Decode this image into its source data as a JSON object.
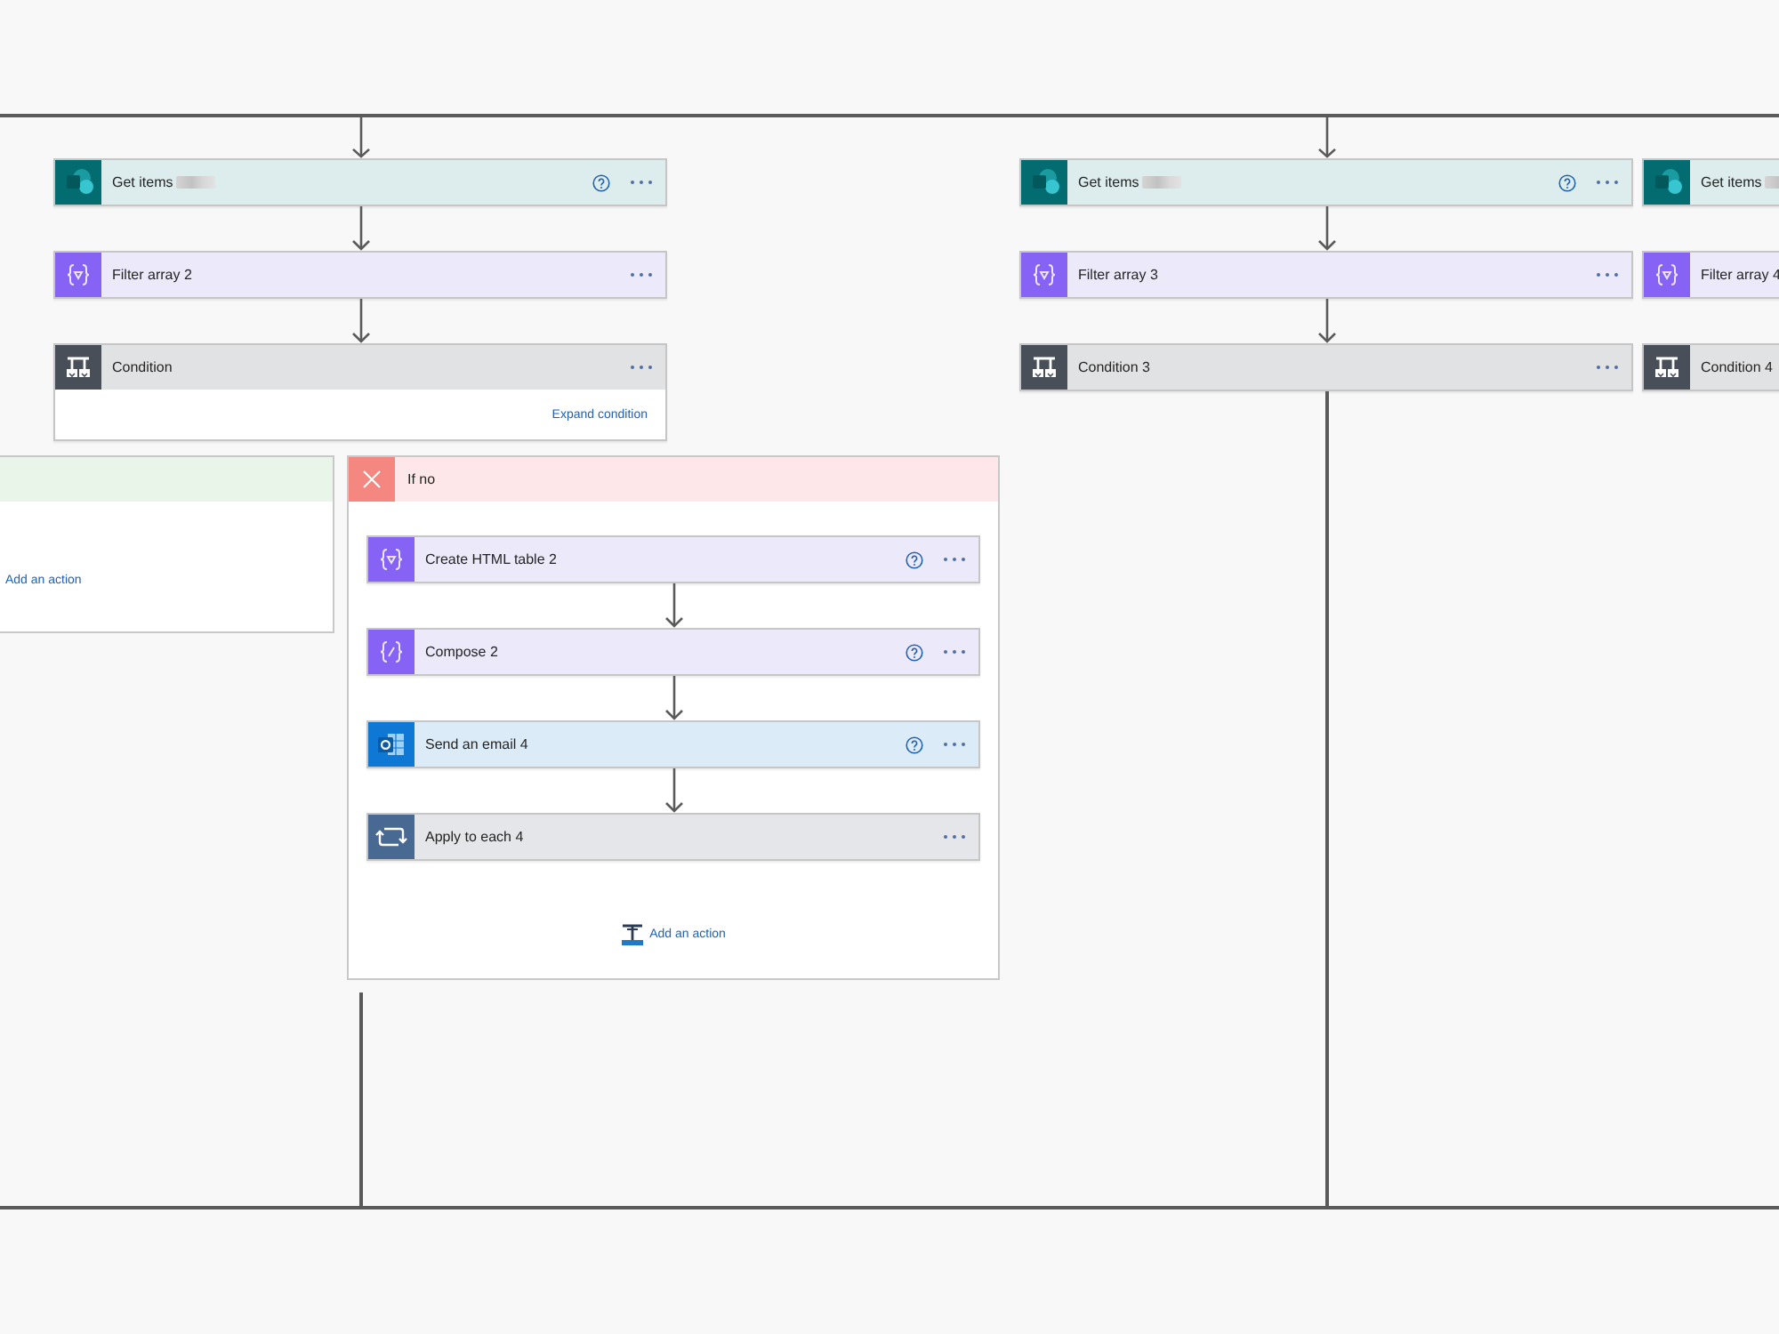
{
  "canvas": {
    "columns": [
      {
        "actions": [
          {
            "kind": "sharepoint",
            "title": "Get items",
            "redacted": true,
            "help": true
          },
          {
            "kind": "filter",
            "title": "Filter array 2",
            "redacted": false,
            "help": false
          }
        ],
        "condition": {
          "title": "Condition",
          "link": "Expand condition"
        },
        "branches": [
          {
            "kind": "yes",
            "add_action": {
              "label": "Add an action",
              "icon": false
            }
          },
          {
            "kind": "no",
            "title": "If no",
            "actions": [
              {
                "kind": "table",
                "title": "Create HTML table 2",
                "redacted": false,
                "help": true
              },
              {
                "kind": "compose",
                "title": "Compose 2",
                "redacted": false,
                "help": true
              },
              {
                "kind": "email",
                "title": "Send an email 4",
                "redacted": false,
                "help": true
              },
              {
                "kind": "loop",
                "title": "Apply to each 4",
                "redacted": false,
                "help": false
              }
            ],
            "add_action": {
              "label": "Add an action",
              "icon": true
            }
          }
        ]
      },
      {
        "actions": [
          {
            "kind": "sharepoint",
            "title": "Get items",
            "redacted": true,
            "help": true
          },
          {
            "kind": "filter",
            "title": "Filter array 3",
            "redacted": false,
            "help": false
          }
        ],
        "condition": {
          "title": "Condition 3"
        }
      },
      {
        "actions": [
          {
            "kind": "sharepoint",
            "title": "Get items",
            "redacted": true
          },
          {
            "kind": "filter",
            "title": "Filter array 4",
            "redacted": false
          }
        ],
        "condition": {
          "title": "Condition 4"
        }
      }
    ]
  }
}
